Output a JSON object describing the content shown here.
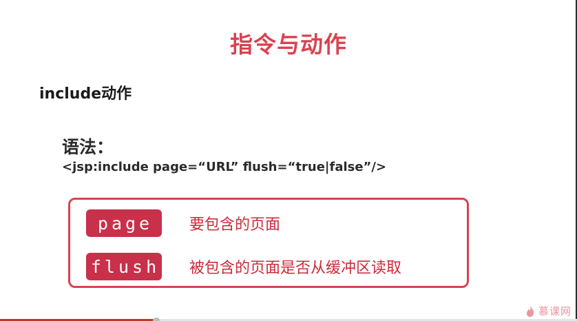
{
  "slide": {
    "title": "指令与动作",
    "section_heading": "include动作",
    "syntax_label": "语法：",
    "syntax_code": "<jsp:include page=“URL” flush=“true|false”/>",
    "attributes": [
      {
        "tag": "page",
        "description": "要包含的页面"
      },
      {
        "tag": "flush",
        "description": "被包含的页面是否从缓冲区读取"
      }
    ]
  },
  "watermark": {
    "text": "慕课网",
    "icon": "flame-logo-icon"
  },
  "player": {
    "progress_fraction": 0.27
  },
  "colors": {
    "accent": "#d9424f",
    "title": "#d9424f",
    "tag_bg": "#c9304a",
    "text_dark": "#1a1a1a"
  }
}
